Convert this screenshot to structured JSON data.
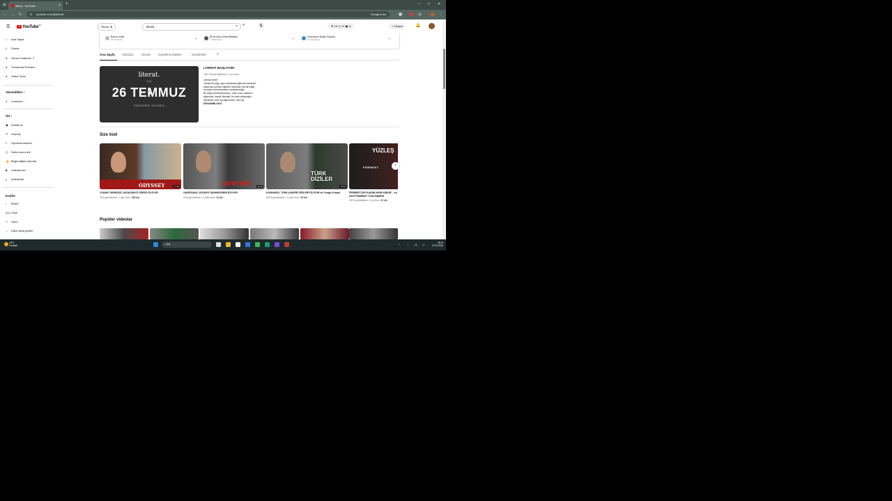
{
  "browser": {
    "tab_title": "literat - YouTube",
    "tab_close": "×",
    "new_tab": "+",
    "url": "youtube.com/@literatt",
    "google_button": "Google'a kur"
  },
  "yt_header": {
    "logo_text": "YouTube",
    "logo_region": "TR",
    "filter_chip": "Filmler",
    "search_value": "literat",
    "search_clear": "×",
    "quick_item_1": "15",
    "quick_item_2": "14",
    "create_label": "Oluştur"
  },
  "sidebar": {
    "top_items": [
      {
        "label": "Ana Sayfa"
      },
      {
        "label": "Shorts"
      },
      {
        "label": "Güncel Haberler"
      },
      {
        "label": "Thumbnail Preview"
      },
      {
        "label": "Video Tools"
      }
    ],
    "subscriptions_heading": "Abonelikler",
    "subscription_item": "Lezbenni",
    "you_heading": "Siz",
    "you_items": [
      {
        "label": "Kanalınız"
      },
      {
        "label": "Geçmiş"
      },
      {
        "label": "Oynatma listeleri"
      },
      {
        "label": "Daha sonra izle"
      },
      {
        "label": "Beğendiğim videolar"
      },
      {
        "label": "Videolarınız"
      },
      {
        "label": "İndirilenler"
      }
    ],
    "explore_heading": "Keşfet",
    "explore_items": [
      {
        "label": "Müzik"
      },
      {
        "label": "Canlı"
      },
      {
        "label": "Oyun"
      },
      {
        "label": "Daha fazla göster"
      }
    ]
  },
  "related_channels": [
    {
      "name": "Bosun Ucalt",
      "subs": "407 B abone"
    },
    {
      "name": "Bi De Bunu Dinle Bakalım",
      "subs": "7,78 B abone"
    },
    {
      "name": "Kosova'nın Böyle Duydun",
      "subs": "1,6 Mn abone"
    }
  ],
  "channel_tabs": [
    "Ana Sayfa",
    "Videolar",
    "Shorts",
    "Oynatma listeleri",
    "Gönderiler"
  ],
  "featured": {
    "brand": "literat.",
    "big_text": "26 TEMMUZ",
    "sub_text": "TARİHİNDE YAYINDA",
    "title": "LITERAT BAŞLIYOR!",
    "meta": "756.796 görüntüleme • 5 yıl önce",
    "description": [
      "Literat nedir?",
      "Literat bir bilgi, aynı zamanda eğlence kanalıdır.",
      "Alanında uzman kişilerle herkesin merak ettiği",
      "konuları derinlemesine inceleyeceğiz.",
      "Bu bilgi bombardımanını, kısa, kısa, kafanızı",
      "eğlenceli, keyifli 'literatik' bir hale sokacağız.",
      "Şimdiden hem iyi eğlenceler, hem iyi",
      "DEVAMINI OKU"
    ]
  },
  "for_you_heading": "Size özel",
  "videos": [
    {
      "title": "YUNAN TARİHÇİSİ, ASSASSIN'S CREED İZLİYOR",
      "meta": "79 B görüntüleme • 3 gün önce",
      "tag": "23B izle",
      "duration": "17:56",
      "overlay": "ODYSSEY"
    },
    {
      "title": "GARDİYANI, CEZAEVİ SAHNELERİNİ İZLİYOR",
      "meta": "76 B görüntüleme • 3 hafta önce",
      "tag": "34 izle",
      "duration": "12:30",
      "overlay": "SIFIR BİR"
    },
    {
      "title": "KOMANDO, TÜRK ASKERİ DİZİLERİ İZLİYOR w/ Cengiz Koçak",
      "meta": "633 B görüntüleme • 12 gün önce",
      "tag": "2D izle",
      "duration": "18:04",
      "overlay": "TÜRK DİZİLER"
    },
    {
      "title": "FEMİNİSTLER KADINLARIN KIŞKIR... vs. ANTİ FEMİNİST YÜZLEŞMESİ",
      "meta": "394 B görüntüleme • 3 yıl önce",
      "tag": "32 izle",
      "duration": "",
      "overlay": "YÜZLEŞ"
    }
  ],
  "popular_heading": "Popüler videolar",
  "taskbar": {
    "temp": "13°C",
    "condition": "Güneşli",
    "search_placeholder": "Ara",
    "time": "18:13",
    "date": "27.06.2024"
  },
  "colors": {
    "brand_red": "#ff0000",
    "chrome_dark": "#3c4b46",
    "taskbar": "#1f2a2c"
  }
}
